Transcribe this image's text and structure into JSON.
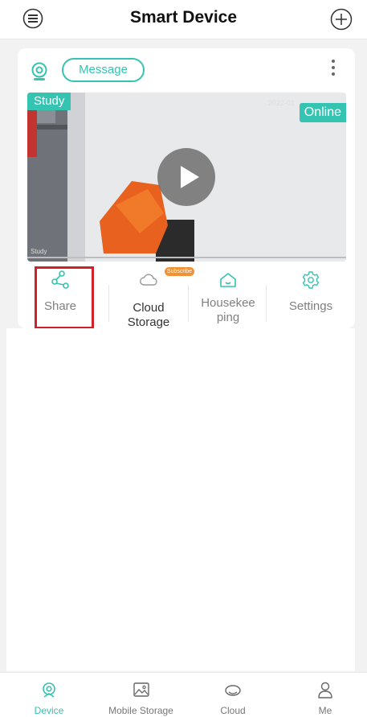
{
  "header": {
    "title": "Smart Device",
    "menu_icon": "menu-icon",
    "add_icon": "plus-circle-icon"
  },
  "device_card": {
    "camera_icon": "camera-icon",
    "message_label": "Message",
    "more_icon": "more-vertical-icon",
    "preview": {
      "room_tag": "Study",
      "status": "Online",
      "timestamp": "2022-01",
      "watermark": "Study",
      "play_icon": "play-icon"
    },
    "actions": [
      {
        "label": "Share",
        "icon": "share-icon"
      },
      {
        "label": "Cloud\nStorage",
        "icon": "cloud-icon",
        "badge": "Subscribe"
      },
      {
        "label": "Housekee\nping",
        "icon": "house-icon"
      },
      {
        "label": "Settings",
        "icon": "gear-icon"
      }
    ]
  },
  "tabbar": {
    "items": [
      {
        "label": "Device",
        "icon": "camera-icon",
        "active": true
      },
      {
        "label": "Mobile Storage",
        "icon": "image-icon",
        "active": false
      },
      {
        "label": "Cloud",
        "icon": "cloud-icon",
        "active": false
      },
      {
        "label": "Me",
        "icon": "user-icon",
        "active": false
      }
    ]
  },
  "colors": {
    "accent": "#35c3b2",
    "badge": "#f09235",
    "highlight": "#d0212a"
  }
}
